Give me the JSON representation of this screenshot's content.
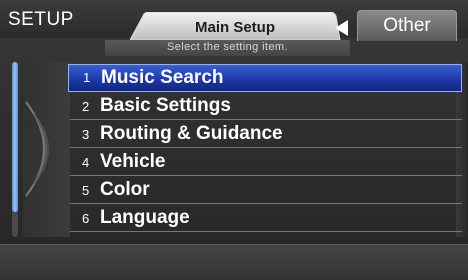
{
  "header": {
    "title": "SETUP",
    "tab_main_label": "Main Setup",
    "tab_other_label": "Other",
    "subtitle": "Select the setting item."
  },
  "menu": {
    "items": [
      {
        "num": "1",
        "label": "Music Search",
        "selected": true
      },
      {
        "num": "2",
        "label": "Basic Settings",
        "selected": false
      },
      {
        "num": "3",
        "label": "Routing & Guidance",
        "selected": false
      },
      {
        "num": "4",
        "label": "Vehicle",
        "selected": false
      },
      {
        "num": "5",
        "label": "Color",
        "selected": false
      },
      {
        "num": "6",
        "label": "Language",
        "selected": false
      }
    ]
  },
  "colors": {
    "selection": "#1d3aa8",
    "selection_border": "#8fb0ff",
    "scroll_accent": "#5b8fd6"
  },
  "icons": {
    "tab_arrow": "triangle-left-icon",
    "knob": "dial-knob-icon"
  }
}
